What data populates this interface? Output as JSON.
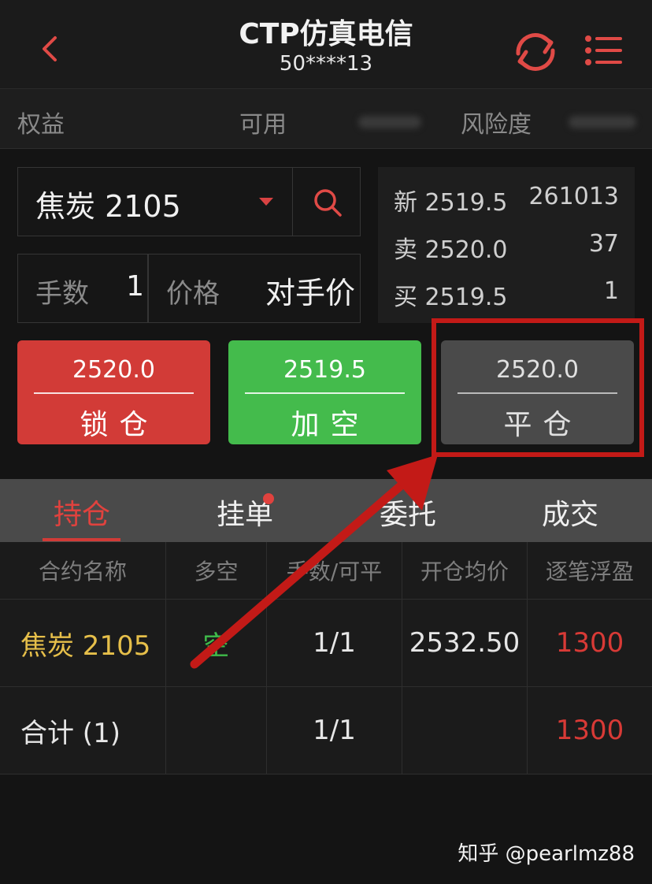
{
  "header": {
    "title": "CTP仿真电信",
    "account": "50****13"
  },
  "info_bar": {
    "equity_label": "权益",
    "available_label": "可用",
    "risk_label": "风险度"
  },
  "order_form": {
    "contract": "焦炭 2105",
    "qty_label": "手数",
    "qty_value": "1",
    "price_label": "价格",
    "price_value": "对手价"
  },
  "quotes": [
    {
      "label": "新 2519.5",
      "value": "261013"
    },
    {
      "label": "卖 2520.0",
      "value": "37"
    },
    {
      "label": "买 2519.5",
      "value": "1"
    }
  ],
  "buttons": {
    "lock": {
      "price": "2520.0",
      "label": "锁仓"
    },
    "short": {
      "price": "2519.5",
      "label": "加空"
    },
    "close": {
      "price": "2520.0",
      "label": "平仓"
    }
  },
  "tabs": [
    "持仓",
    "挂单",
    "委托",
    "成交"
  ],
  "table": {
    "headers": [
      "合约名称",
      "多空",
      "手数/可平",
      "开仓均价",
      "逐笔浮盈"
    ],
    "rows": [
      [
        "焦炭 2105",
        "空",
        "1/1",
        "2532.50",
        "1300"
      ],
      [
        "合计 (1)",
        "",
        "1/1",
        "",
        "1300"
      ]
    ]
  },
  "colors": {
    "accent": "#d23b37",
    "green": "#44bb4c",
    "gold": "#e6bf4a",
    "annotation": "#c31a17"
  },
  "watermark": "知乎 @pearlmz88"
}
